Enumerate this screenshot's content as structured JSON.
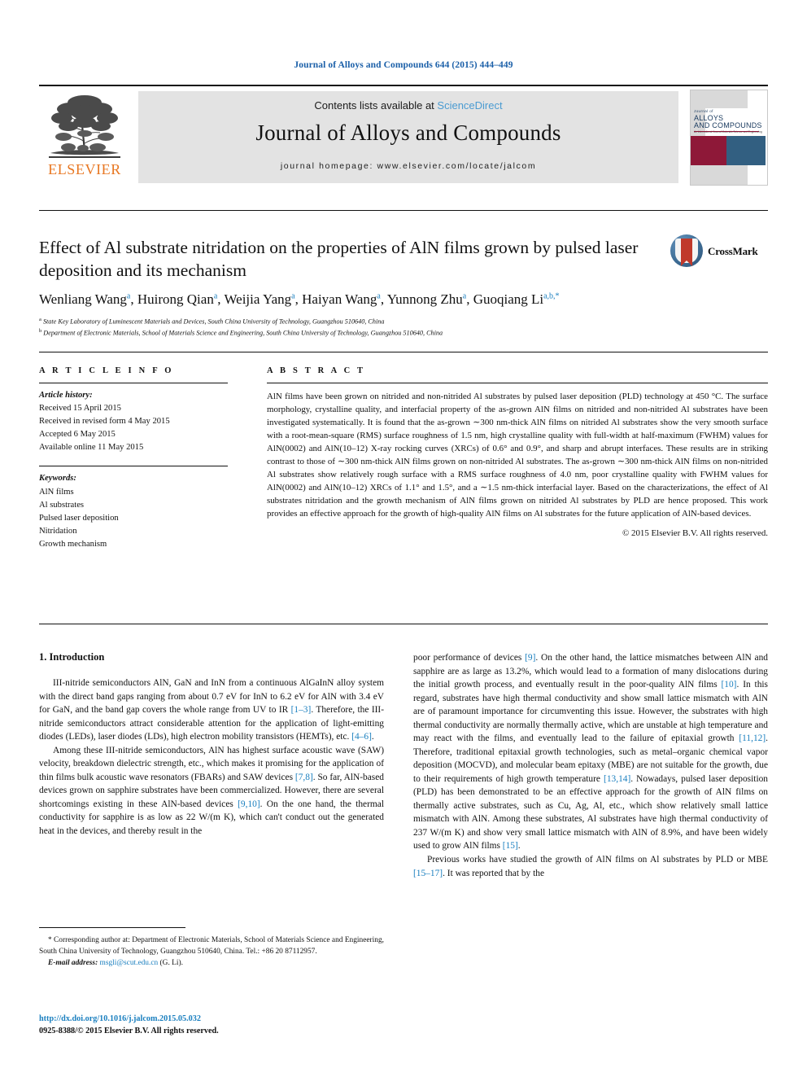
{
  "running_head": "Journal of Alloys and Compounds 644 (2015) 444–449",
  "masthead": {
    "contents_prefix": "Contents lists available at ",
    "sciencedirect": "ScienceDirect",
    "journal_name": "Journal of Alloys and Compounds",
    "homepage": "journal homepage: www.elsevier.com/locate/jalcom",
    "publisher_wordmark": "ELSEVIER",
    "cover": {
      "line1": "Journal of",
      "line2": "ALLOYS",
      "line3": "AND COMPOUNDS",
      "line4": "An International Journal Materials Science and Engineering"
    }
  },
  "article": {
    "title": "Effect of Al substrate nitridation on the properties of AlN films grown by pulsed laser deposition and its mechanism",
    "crossmark_label": "CrossMark",
    "authors_html": "Wenliang Wang<sup>a</sup>, Huirong Qian<sup>a</sup>, Weijia Yang<sup>a</sup>, Haiyan Wang<sup>a</sup>, Yunnong Zhu<sup>a</sup>, Guoqiang Li<sup>a,b,*</sup>",
    "affiliation_a": "State Key Laboratory of Luminescent Materials and Devices, South China University of Technology, Guangzhou 510640, China",
    "affiliation_b": "Department of Electronic Materials, School of Materials Science and Engineering, South China University of Technology, Guangzhou 510640, China"
  },
  "info": {
    "heading": "A R T I C L E    I N F O",
    "history_label": "Article history:",
    "history": [
      "Received 15 April 2015",
      "Received in revised form 4 May 2015",
      "Accepted 6 May 2015",
      "Available online 11 May 2015"
    ],
    "keywords_label": "Keywords:",
    "keywords": [
      "AlN films",
      "Al substrates",
      "Pulsed laser deposition",
      "Nitridation",
      "Growth mechanism"
    ]
  },
  "abstract": {
    "heading": "A B S T R A C T",
    "text": "AlN films have been grown on nitrided and non-nitrided Al substrates by pulsed laser deposition (PLD) technology at 450 °C. The surface morphology, crystalline quality, and interfacial property of the as-grown AlN films on nitrided and non-nitrided Al substrates have been investigated systematically. It is found that the as-grown ∼300 nm-thick AlN films on nitrided Al substrates show the very smooth surface with a root-mean-square (RMS) surface roughness of 1.5 nm, high crystalline quality with full-width at half-maximum (FWHM) values for AlN(0002) and AlN(10–12) X-ray rocking curves (XRCs) of 0.6° and 0.9°, and sharp and abrupt interfaces. These results are in striking contrast to those of ∼300 nm-thick AlN films grown on non-nitrided Al substrates. The as-grown ∼300 nm-thick AlN films on non-nitrided Al substrates show relatively rough surface with a RMS surface roughness of 4.0 nm, poor crystalline quality with FWHM values for AlN(0002) and AlN(10–12) XRCs of 1.1° and 1.5°, and a ∼1.5 nm-thick interfacial layer. Based on the characterizations, the effect of Al substrates nitridation and the growth mechanism of AlN films grown on nitrided Al substrates by PLD are hence proposed. This work provides an effective approach for the growth of high-quality AlN films on Al substrates for the future application of AlN-based devices.",
    "copyright": "© 2015 Elsevier B.V. All rights reserved."
  },
  "body": {
    "section_title": "1. Introduction",
    "left_paragraphs": [
      "III-nitride semiconductors AlN, GaN and InN from a continuous AlGaInN alloy system with the direct band gaps ranging from about 0.7 eV for InN to 6.2 eV for AlN with 3.4 eV for GaN, and the band gap covers the whole range from UV to IR [1–3]. Therefore, the III-nitride semiconductors attract considerable attention for the application of light-emitting diodes (LEDs), laser diodes (LDs), high electron mobility transistors (HEMTs), etc. [4–6].",
      "Among these III-nitride semiconductors, AlN has highest surface acoustic wave (SAW) velocity, breakdown dielectric strength, etc., which makes it promising for the application of thin films bulk acoustic wave resonators (FBARs) and SAW devices [7,8]. So far, AlN-based devices grown on sapphire substrates have been commercialized. However, there are several shortcomings existing in these AlN-based devices [9,10]. On the one hand, the thermal conductivity for sapphire is as low as 22 W/(m K), which can't conduct out the generated heat in the devices, and thereby result in the"
    ],
    "right_paragraphs": [
      "poor performance of devices [9]. On the other hand, the lattice mismatches between AlN and sapphire are as large as 13.2%, which would lead to a formation of many dislocations during the initial growth process, and eventually result in the poor-quality AlN films [10]. In this regard, substrates have high thermal conductivity and show small lattice mismatch with AlN are of paramount importance for circumventing this issue. However, the substrates with high thermal conductivity are normally thermally active, which are unstable at high temperature and may react with the films, and eventually lead to the failure of epitaxial growth [11,12]. Therefore, traditional epitaxial growth technologies, such as metal–organic chemical vapor deposition (MOCVD), and molecular beam epitaxy (MBE) are not suitable for the growth, due to their requirements of high growth temperature [13,14]. Nowadays, pulsed laser deposition (PLD) has been demonstrated to be an effective approach for the growth of AlN films on thermally active substrates, such as Cu, Ag, Al, etc., which show relatively small lattice mismatch with AlN. Among these substrates, Al substrates have high thermal conductivity of 237 W/(m K) and show very small lattice mismatch with AlN of 8.9%, and have been widely used to grow AlN films [15].",
      "Previous works have studied the growth of AlN films on Al substrates by PLD or MBE [15–17]. It was reported that by the"
    ]
  },
  "footer": {
    "corresponding_note": "* Corresponding author at: Department of Electronic Materials, School of Materials Science and Engineering, South China University of Technology, Guangzhou 510640, China. Tel.: +86 20 87112957.",
    "email_label": "E-mail address:",
    "email": "msgli@scut.edu.cn",
    "email_suffix": "(G. Li).",
    "doi": "http://dx.doi.org/10.1016/j.jalcom.2015.05.032",
    "issn_line": "0925-8388/© 2015 Elsevier B.V. All rights reserved."
  },
  "colors": {
    "link_blue": "#1a7fbf",
    "header_blue": "#1a5fa8",
    "elsevier_orange": "#E87722",
    "cover_red": "#8e1838",
    "cover_blue": "#325f81"
  }
}
